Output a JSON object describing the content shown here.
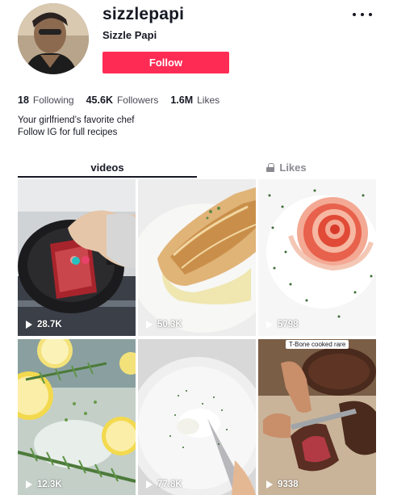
{
  "profile": {
    "username": "sizzlepapi",
    "display_name": "Sizzle Papi",
    "follow_label": "Follow",
    "more_icon": "more-horizontal-icon"
  },
  "stats": [
    {
      "value": "18",
      "label": "Following"
    },
    {
      "value": "45.6K",
      "label": "Followers"
    },
    {
      "value": "1.6M",
      "label": "Likes"
    }
  ],
  "bio": {
    "line1": "Your girlfriend’s favorite chef",
    "line2": "Follow IG for full recipes"
  },
  "tabs": [
    {
      "label": "videos",
      "active": true
    },
    {
      "label": "Likes",
      "active": false,
      "icon": "lock-icon"
    }
  ],
  "videos": [
    {
      "views": "28.7K"
    },
    {
      "views": "50.3K"
    },
    {
      "views": "5798"
    },
    {
      "views": "12.3K"
    },
    {
      "views": "77.8K"
    },
    {
      "views": "9338",
      "caption": "T-Bone cooked rare"
    }
  ],
  "colors": {
    "accent": "#fe2c55",
    "text": "#161823",
    "muted": "#8a8b91"
  }
}
